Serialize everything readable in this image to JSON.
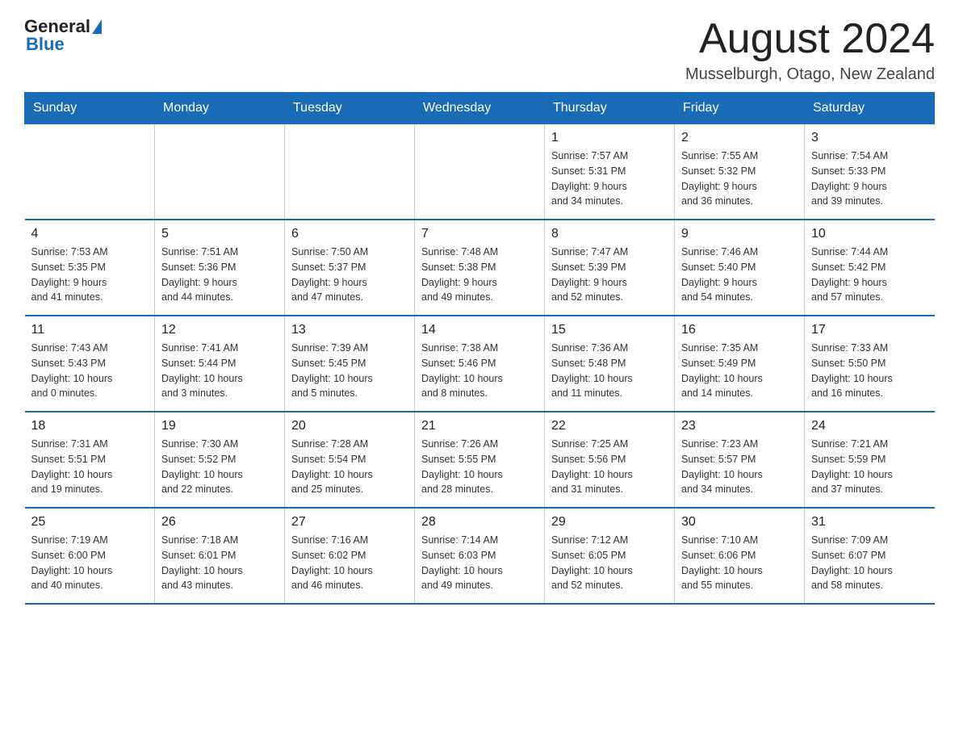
{
  "header": {
    "logo_general": "General",
    "logo_blue": "Blue",
    "month_title": "August 2024",
    "location": "Musselburgh, Otago, New Zealand"
  },
  "days_of_week": [
    "Sunday",
    "Monday",
    "Tuesday",
    "Wednesday",
    "Thursday",
    "Friday",
    "Saturday"
  ],
  "weeks": [
    [
      {
        "day": "",
        "info": ""
      },
      {
        "day": "",
        "info": ""
      },
      {
        "day": "",
        "info": ""
      },
      {
        "day": "",
        "info": ""
      },
      {
        "day": "1",
        "info": "Sunrise: 7:57 AM\nSunset: 5:31 PM\nDaylight: 9 hours\nand 34 minutes."
      },
      {
        "day": "2",
        "info": "Sunrise: 7:55 AM\nSunset: 5:32 PM\nDaylight: 9 hours\nand 36 minutes."
      },
      {
        "day": "3",
        "info": "Sunrise: 7:54 AM\nSunset: 5:33 PM\nDaylight: 9 hours\nand 39 minutes."
      }
    ],
    [
      {
        "day": "4",
        "info": "Sunrise: 7:53 AM\nSunset: 5:35 PM\nDaylight: 9 hours\nand 41 minutes."
      },
      {
        "day": "5",
        "info": "Sunrise: 7:51 AM\nSunset: 5:36 PM\nDaylight: 9 hours\nand 44 minutes."
      },
      {
        "day": "6",
        "info": "Sunrise: 7:50 AM\nSunset: 5:37 PM\nDaylight: 9 hours\nand 47 minutes."
      },
      {
        "day": "7",
        "info": "Sunrise: 7:48 AM\nSunset: 5:38 PM\nDaylight: 9 hours\nand 49 minutes."
      },
      {
        "day": "8",
        "info": "Sunrise: 7:47 AM\nSunset: 5:39 PM\nDaylight: 9 hours\nand 52 minutes."
      },
      {
        "day": "9",
        "info": "Sunrise: 7:46 AM\nSunset: 5:40 PM\nDaylight: 9 hours\nand 54 minutes."
      },
      {
        "day": "10",
        "info": "Sunrise: 7:44 AM\nSunset: 5:42 PM\nDaylight: 9 hours\nand 57 minutes."
      }
    ],
    [
      {
        "day": "11",
        "info": "Sunrise: 7:43 AM\nSunset: 5:43 PM\nDaylight: 10 hours\nand 0 minutes."
      },
      {
        "day": "12",
        "info": "Sunrise: 7:41 AM\nSunset: 5:44 PM\nDaylight: 10 hours\nand 3 minutes."
      },
      {
        "day": "13",
        "info": "Sunrise: 7:39 AM\nSunset: 5:45 PM\nDaylight: 10 hours\nand 5 minutes."
      },
      {
        "day": "14",
        "info": "Sunrise: 7:38 AM\nSunset: 5:46 PM\nDaylight: 10 hours\nand 8 minutes."
      },
      {
        "day": "15",
        "info": "Sunrise: 7:36 AM\nSunset: 5:48 PM\nDaylight: 10 hours\nand 11 minutes."
      },
      {
        "day": "16",
        "info": "Sunrise: 7:35 AM\nSunset: 5:49 PM\nDaylight: 10 hours\nand 14 minutes."
      },
      {
        "day": "17",
        "info": "Sunrise: 7:33 AM\nSunset: 5:50 PM\nDaylight: 10 hours\nand 16 minutes."
      }
    ],
    [
      {
        "day": "18",
        "info": "Sunrise: 7:31 AM\nSunset: 5:51 PM\nDaylight: 10 hours\nand 19 minutes."
      },
      {
        "day": "19",
        "info": "Sunrise: 7:30 AM\nSunset: 5:52 PM\nDaylight: 10 hours\nand 22 minutes."
      },
      {
        "day": "20",
        "info": "Sunrise: 7:28 AM\nSunset: 5:54 PM\nDaylight: 10 hours\nand 25 minutes."
      },
      {
        "day": "21",
        "info": "Sunrise: 7:26 AM\nSunset: 5:55 PM\nDaylight: 10 hours\nand 28 minutes."
      },
      {
        "day": "22",
        "info": "Sunrise: 7:25 AM\nSunset: 5:56 PM\nDaylight: 10 hours\nand 31 minutes."
      },
      {
        "day": "23",
        "info": "Sunrise: 7:23 AM\nSunset: 5:57 PM\nDaylight: 10 hours\nand 34 minutes."
      },
      {
        "day": "24",
        "info": "Sunrise: 7:21 AM\nSunset: 5:59 PM\nDaylight: 10 hours\nand 37 minutes."
      }
    ],
    [
      {
        "day": "25",
        "info": "Sunrise: 7:19 AM\nSunset: 6:00 PM\nDaylight: 10 hours\nand 40 minutes."
      },
      {
        "day": "26",
        "info": "Sunrise: 7:18 AM\nSunset: 6:01 PM\nDaylight: 10 hours\nand 43 minutes."
      },
      {
        "day": "27",
        "info": "Sunrise: 7:16 AM\nSunset: 6:02 PM\nDaylight: 10 hours\nand 46 minutes."
      },
      {
        "day": "28",
        "info": "Sunrise: 7:14 AM\nSunset: 6:03 PM\nDaylight: 10 hours\nand 49 minutes."
      },
      {
        "day": "29",
        "info": "Sunrise: 7:12 AM\nSunset: 6:05 PM\nDaylight: 10 hours\nand 52 minutes."
      },
      {
        "day": "30",
        "info": "Sunrise: 7:10 AM\nSunset: 6:06 PM\nDaylight: 10 hours\nand 55 minutes."
      },
      {
        "day": "31",
        "info": "Sunrise: 7:09 AM\nSunset: 6:07 PM\nDaylight: 10 hours\nand 58 minutes."
      }
    ]
  ]
}
